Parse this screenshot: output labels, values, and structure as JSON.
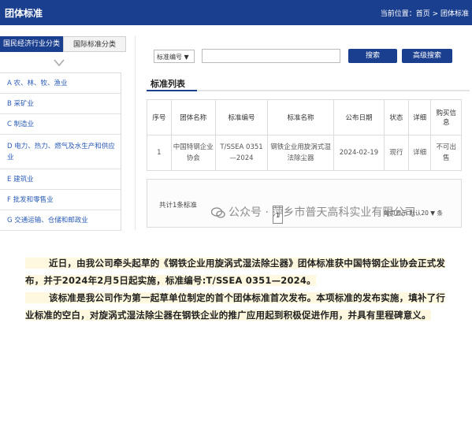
{
  "header": {
    "title": "团体标准",
    "breadcrumb": "当前位置：首页 > 团体标准"
  },
  "tabs": [
    {
      "label": "国民经济行业分类"
    },
    {
      "label": "国际标准分类"
    }
  ],
  "categories": [
    "A 农、林、牧、渔业",
    "B 采矿业",
    "C 制造业",
    "D 电力、热力、燃气及水生产和供应业",
    "E 建筑业",
    "F 批发和零售业",
    "G 交通运输、仓储和邮政业"
  ],
  "search": {
    "select_label": "标准编号 ▼",
    "search_button": "搜索",
    "advanced_button": "高级搜索"
  },
  "list": {
    "title": "标准列表",
    "columns": [
      "序号",
      "团体名称",
      "标准编号",
      "标准名称",
      "公布日期",
      "状态",
      "详细",
      "购买信息"
    ],
    "rows": [
      [
        "1",
        "中国特钢企业协会",
        "T/SSEA 0351—2024",
        "钢铁企业用旋涡式湿法除尘器",
        "2024-02-19",
        "现行",
        "详细",
        "不可出售"
      ]
    ]
  },
  "pagination": {
    "total": "共计1条标准",
    "page": "1",
    "per_page": "每页显示 默认20 ▼ 条"
  },
  "watermark": "公众号 · 萍乡市普天高科实业有限公司",
  "colors": {
    "header_bg": "#1b3f8f",
    "link": "#2a5bb8",
    "highlight": "#fdf8df"
  },
  "article": {
    "p1": "近日，由我公司牵头起草的《钢铁企业用旋涡式湿法除尘器》团体标准获中国特钢企业协会正式发布，并于2024年2月5日起实施，标准编号:T/SSEA 0351—2024。",
    "p2": "该标准是我公司作为第一起草单位制定的首个团体标准首次发布。本项标准的发布实施，填补了行业标准的空白，对旋涡式湿法除尘器在钢铁企业的推广应用起到积极促进作用，并具有里程碑意义。"
  }
}
